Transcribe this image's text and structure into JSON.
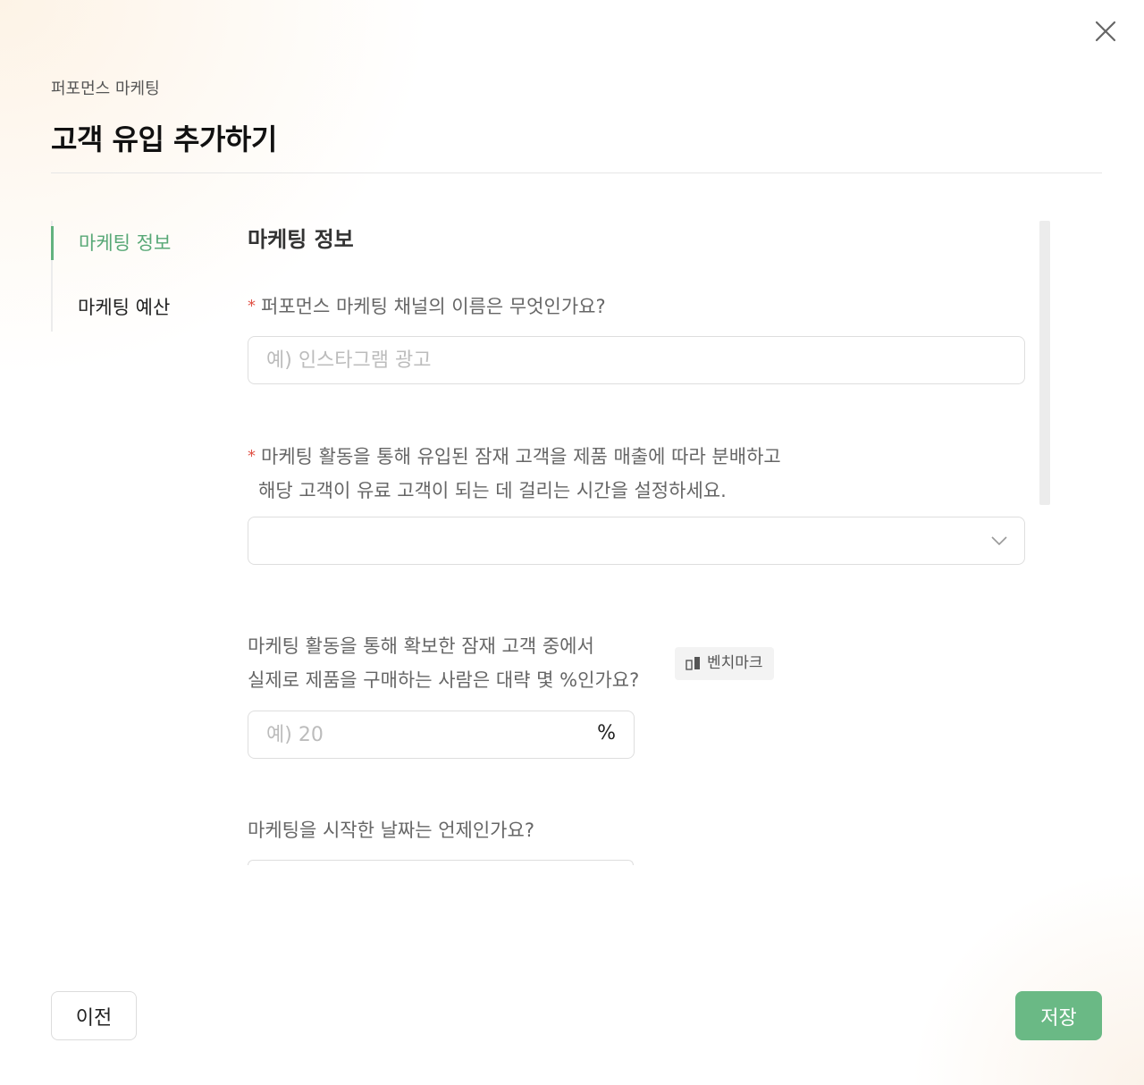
{
  "header": {
    "breadcrumb": "퍼포먼스 마케팅",
    "title": "고객 유입 추가하기"
  },
  "icons": {
    "close": "close-icon",
    "chevron": "chevron-down-icon",
    "benchmark": "bar-chart-icon"
  },
  "colors": {
    "accent": "#6ab985",
    "required": "#e05246"
  },
  "nav": {
    "items": [
      {
        "label": "마케팅 정보",
        "active": true
      },
      {
        "label": "마케팅 예산",
        "active": false
      }
    ]
  },
  "form": {
    "section_title": "마케팅 정보",
    "q1": {
      "required_mark": "*",
      "label": "퍼포먼스 마케팅 채널의 이름은 무엇인가요?",
      "placeholder": "예) 인스타그램 광고"
    },
    "q2": {
      "required_mark": "*",
      "label_line1": "마케팅 활동을 통해 유입된 잠재 고객을 제품 매출에 따라 분배하고",
      "label_line2": "해당 고객이 유료 고객이 되는 데 걸리는 시간을 설정하세요.",
      "selected": ""
    },
    "q3": {
      "label_line1": "마케팅 활동을 통해 확보한 잠재 고객 중에서",
      "label_line2": "실제로 제품을 구매하는 사람은 대략 몇 %인가요?",
      "benchmark_label": "벤치마크",
      "placeholder": "예) 20",
      "unit": "%"
    },
    "q4": {
      "label": "마케팅을 시작한 날짜는 언제인가요?"
    }
  },
  "footer": {
    "prev_label": "이전",
    "save_label": "저장"
  }
}
